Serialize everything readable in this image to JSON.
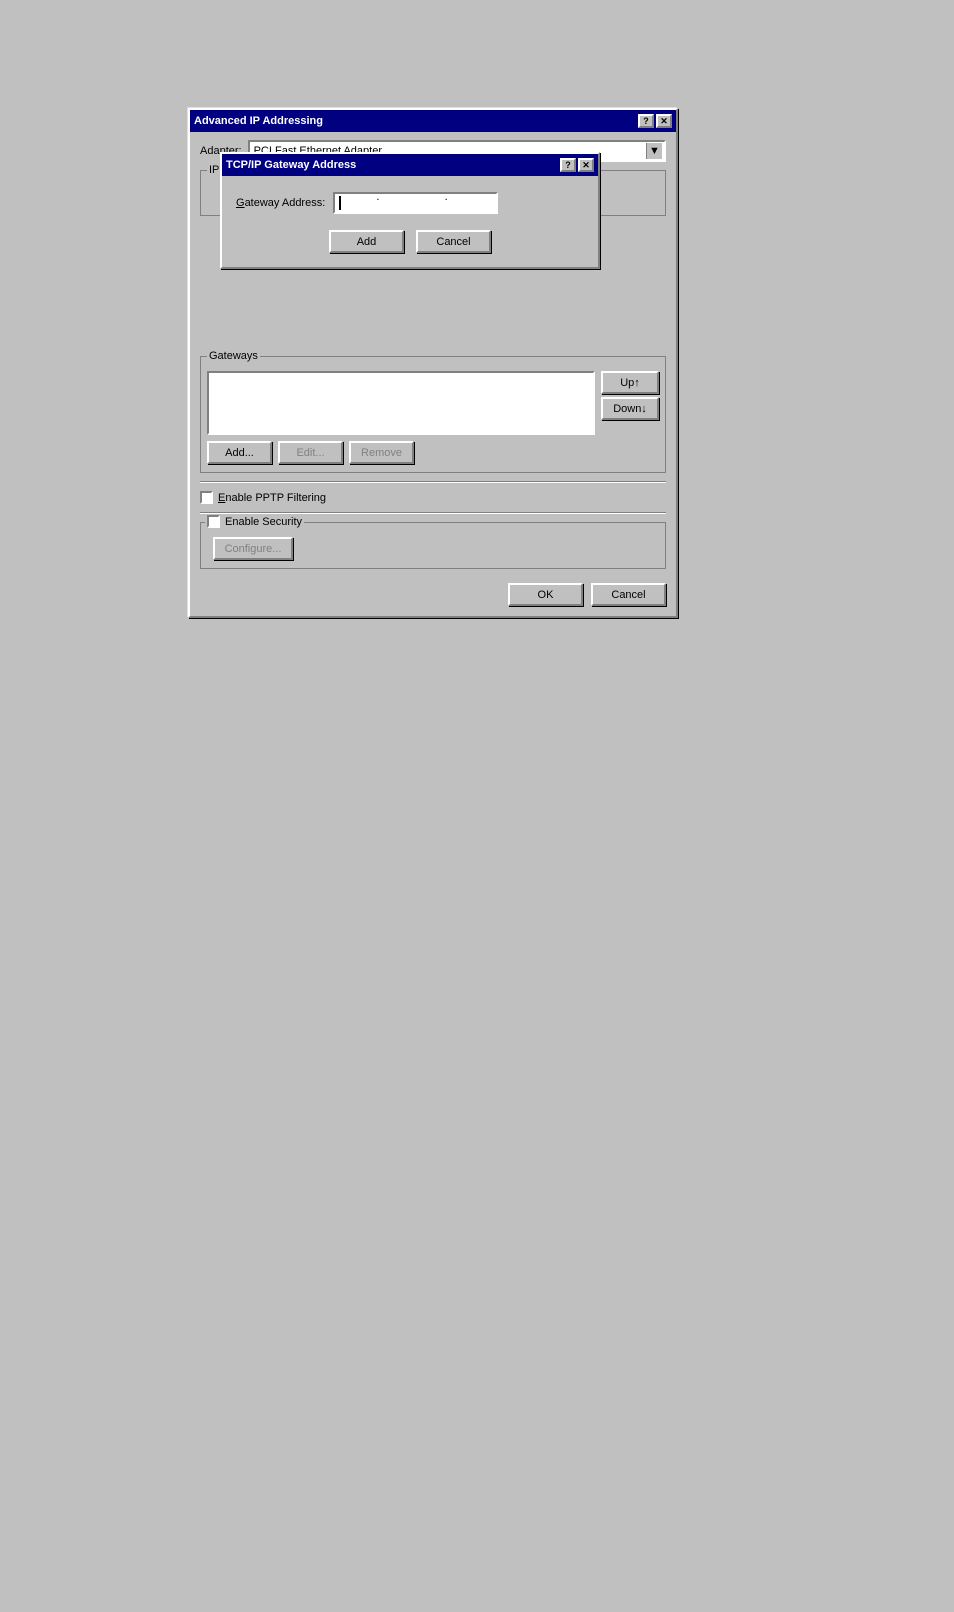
{
  "background": "#c0c0c0",
  "advanced_dialog": {
    "title": "Advanced IP Addressing",
    "help_btn": "?",
    "close_btn": "✕",
    "adapter_label": "Adapter:",
    "adapter_value": "PCI Fast Ethernet Adapter",
    "ip_group_label": "IP",
    "gateways_group_label": "Gateways",
    "gateways_up_btn": "Up↑",
    "gateways_down_btn": "Down↓",
    "gateways_add_btn": "Add...",
    "gateways_edit_btn": "Edit...",
    "gateways_remove_btn": "Remove",
    "pptp_label": "Enable PPTP Filtering",
    "security_label": "Enable Security",
    "configure_btn": "Configure...",
    "ok_btn": "OK",
    "cancel_btn": "Cancel"
  },
  "tcp_dialog": {
    "title": "TCP/IP Gateway Address",
    "help_btn": "?",
    "close_btn": "✕",
    "gateway_label": "Gateway Address:",
    "gateway_placeholder": ". . .",
    "add_btn": "Add",
    "cancel_btn": "Cancel"
  }
}
